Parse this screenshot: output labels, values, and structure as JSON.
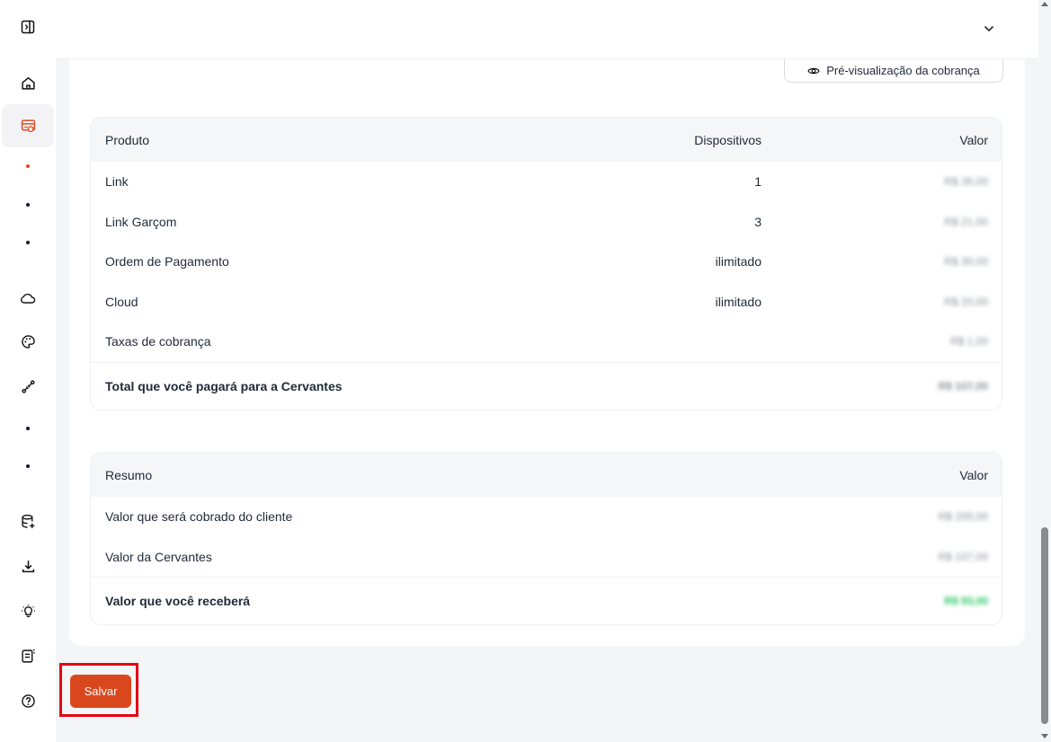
{
  "preview_button": {
    "label": "Pré-visualização da cobrança"
  },
  "products_table": {
    "headers": {
      "product": "Produto",
      "devices": "Dispositivos",
      "value": "Valor"
    },
    "rows": [
      {
        "product": "Link",
        "devices": "1",
        "value": "R$ 35,00"
      },
      {
        "product": "Link Garçom",
        "devices": "3",
        "value": "R$ 21,00"
      },
      {
        "product": "Ordem de Pagamento",
        "devices": "ilimitado",
        "value": "R$ 30,00"
      },
      {
        "product": "Cloud",
        "devices": "ilimitado",
        "value": "R$ 20,00"
      },
      {
        "product": "Taxas de cobrança",
        "devices": "",
        "value": "R$ 1,00"
      }
    ],
    "total": {
      "label": "Total que você pagará para a Cervantes",
      "value": "R$ 107,00"
    }
  },
  "summary_table": {
    "headers": {
      "summary": "Resumo",
      "value": "Valor"
    },
    "rows": [
      {
        "label": "Valor que será cobrado do cliente",
        "value": "R$ 200,00"
      },
      {
        "label": "Valor da Cervantes",
        "value": "R$ 107,00"
      }
    ],
    "total": {
      "label": "Valor que você receberá",
      "value": "R$ 93,00"
    }
  },
  "save_button": {
    "label": "Salvar"
  },
  "sidebar": {
    "icons": [
      "panel-toggle-icon",
      "home-icon",
      "billing-icon",
      "cloud-icon",
      "palette-icon",
      "integration-icon",
      "database-add-icon",
      "download-icon",
      "lightbulb-icon",
      "report-icon",
      "help-icon"
    ]
  },
  "colors": {
    "accent": "#d9481d",
    "highlight_border": "#e30613",
    "positive": "#22c55e"
  }
}
